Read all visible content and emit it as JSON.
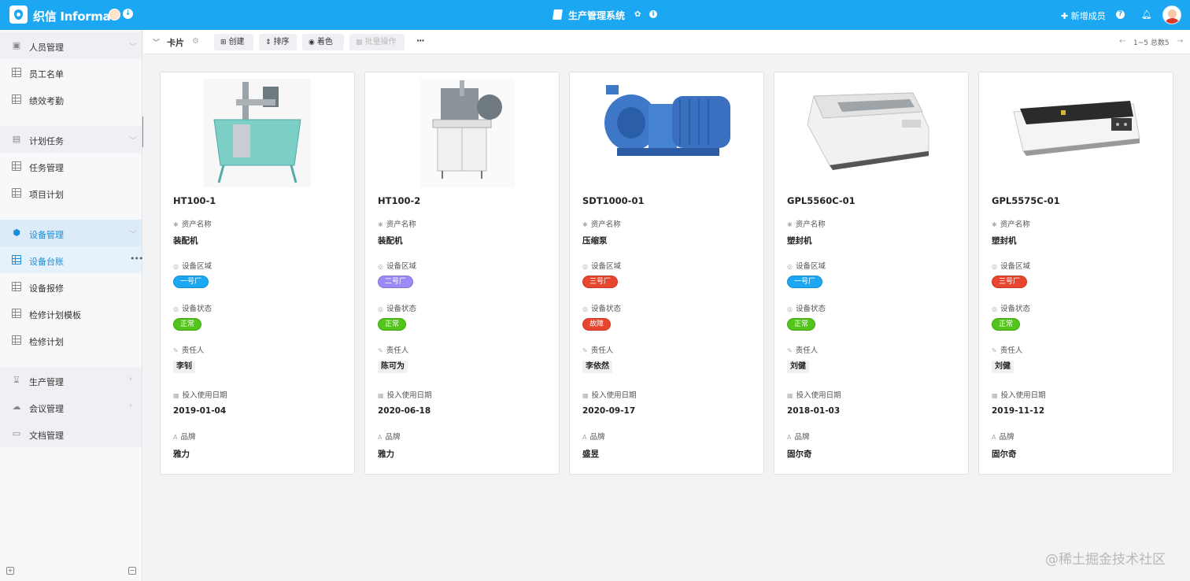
{
  "header": {
    "brand": "织信 Informat",
    "app_title": "生产管理系统",
    "new_member": "新增成员",
    "help": "?",
    "download": "↓",
    "info": "i"
  },
  "sidebar": {
    "groups": [
      {
        "label": "人员管理",
        "icon": "person-icon",
        "items": [
          "员工名单",
          "绩效考勤"
        ]
      },
      {
        "label": "计划任务",
        "icon": "calendar-icon",
        "items": [
          "任务管理",
          "项目计划"
        ]
      },
      {
        "label": "设备管理",
        "icon": "cube-icon",
        "items": [
          "设备台账",
          "设备报修",
          "检修计划模板",
          "检修计划"
        ]
      },
      {
        "label": "生产管理",
        "icon": "hourglass-icon",
        "items": []
      },
      {
        "label": "会议管理",
        "icon": "cloud-icon",
        "items": []
      },
      {
        "label": "文档管理",
        "icon": "folder-icon",
        "items": []
      }
    ],
    "selected": "设备台账"
  },
  "toolbar": {
    "view_name": "卡片",
    "buttons": [
      "创建",
      "排序",
      "着色",
      "批量操作"
    ],
    "more": "···",
    "pager": "1~5 总数5"
  },
  "cards": [
    {
      "title": "HT100-1",
      "asset_label": "资产名称",
      "asset": "装配机",
      "area_label": "设备区域",
      "area": "一号厂",
      "status_label": "设备状态",
      "status": "正常",
      "owner_label": "责任人",
      "owner": "李钊",
      "date_label": "投入使用日期",
      "date": "2019-01-04",
      "brand_label": "品牌",
      "brand": "雅力"
    },
    {
      "title": "HT100-2",
      "asset_label": "资产名称",
      "asset": "装配机",
      "area_label": "设备区域",
      "area": "二号厂",
      "status_label": "设备状态",
      "status": "正常",
      "owner_label": "责任人",
      "owner": "陈可为",
      "date_label": "投入使用日期",
      "date": "2020-06-18",
      "brand_label": "品牌",
      "brand": "雅力"
    },
    {
      "title": "SDT1000-01",
      "asset_label": "资产名称",
      "asset": "压缩泵",
      "area_label": "设备区域",
      "area": "三号厂",
      "status_label": "设备状态",
      "status": "故障",
      "owner_label": "责任人",
      "owner": "李依然",
      "date_label": "投入使用日期",
      "date": "2020-09-17",
      "brand_label": "品牌",
      "brand": "盛昱"
    },
    {
      "title": "GPL5560C-01",
      "asset_label": "资产名称",
      "asset": "塑封机",
      "area_label": "设备区域",
      "area": "一号厂",
      "status_label": "设备状态",
      "status": "正常",
      "owner_label": "责任人",
      "owner": "刘健",
      "date_label": "投入使用日期",
      "date": "2018-01-03",
      "brand_label": "品牌",
      "brand": "固尔奇"
    },
    {
      "title": "GPL5575C-01",
      "asset_label": "资产名称",
      "asset": "塑封机",
      "area_label": "设备区域",
      "area": "三号厂",
      "status_label": "设备状态",
      "status": "正常",
      "owner_label": "责任人",
      "owner": "刘健",
      "date_label": "投入使用日期",
      "date": "2019-11-12",
      "brand_label": "品牌",
      "brand": "固尔奇"
    }
  ],
  "colors": {
    "header": "#1ba7f2",
    "area_one": "#1ba7f2",
    "area_two": "#9b8af5",
    "area_three": "#e8452f",
    "status_ok": "#52c41a",
    "status_fault": "#e8452f"
  },
  "watermark": "@稀土掘金技术社区"
}
